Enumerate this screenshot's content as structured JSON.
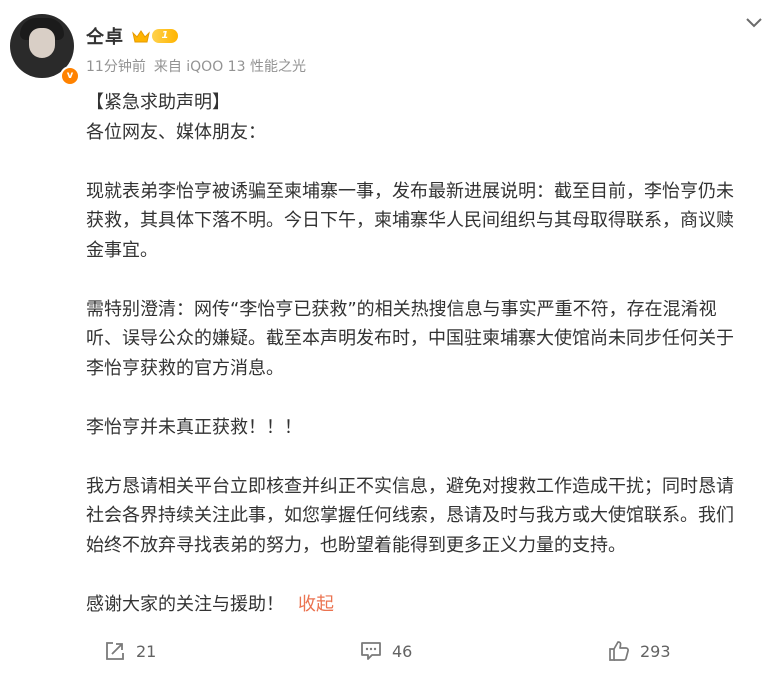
{
  "user": {
    "name": "仝卓",
    "level": "1",
    "verified_mark": "v"
  },
  "meta": {
    "time": "11分钟前",
    "source": "来自 iQOO 13 性能之光"
  },
  "post": {
    "lines": [
      "【紧急求助声明】",
      "各位网友、媒体朋友：",
      "",
      "现就表弟李怡亨被诱骗至柬埔寨一事，发布最新进展说明：截至目前，李怡亨仍未",
      "获救，其具体下落不明。今日下午，柬埔寨华人民间组织与其母取得联系，商议赎",
      "金事宜。",
      "",
      "需特别澄清：网传“李怡亨已获救”的相关热搜信息与事实严重不符，存在混淆视",
      "听、误导公众的嫌疑。截至本声明发布时，中国驻柬埔寨大使馆尚未同步任何关于",
      "李怡亨获救的官方消息。",
      "",
      "李怡亨并未真正获救！！！",
      "",
      "我方恳请相关平台立即核查并纠正不实信息，避免对搜救工作造成干扰；同时恳请",
      "社会各界持续关注此事，如您掌握任何线索，恳请及时与我方或大使馆联系。我们",
      "始终不放弃寻找表弟的努力，也盼望着能得到更多正义力量的支持。",
      "",
      "感谢大家的关注与援助！"
    ],
    "collapse_label": "收起"
  },
  "actions": {
    "repost_count": "21",
    "comment_count": "46",
    "like_count": "293"
  },
  "colors": {
    "accent": "#eb7350",
    "verified": "#ff8200",
    "meta_text": "#939393"
  }
}
